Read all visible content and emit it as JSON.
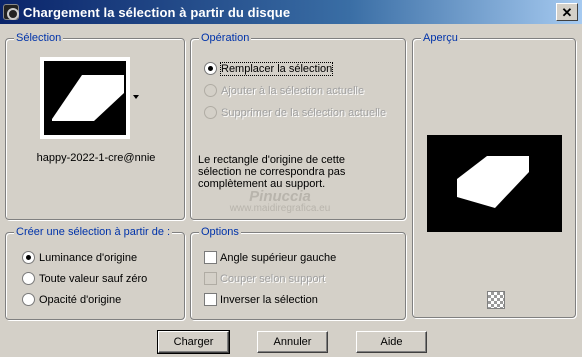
{
  "window": {
    "title": "Chargement la sélection à partir du disque",
    "close_label": "✕"
  },
  "selection_group": {
    "legend": "Sélection",
    "filename": "happy-2022-1-cre@nnie"
  },
  "operation_group": {
    "legend": "Opération",
    "options": [
      {
        "label": "Remplacer la sélection",
        "checked": true,
        "enabled": true
      },
      {
        "label": "Ajouter à la sélection actuelle",
        "checked": false,
        "enabled": false
      },
      {
        "label": "Supprimer de la sélection actuelle",
        "checked": false,
        "enabled": false
      }
    ],
    "message": "Le rectangle d'origine de cette sélection ne correspondra pas complètement au support."
  },
  "preview_group": {
    "legend": "Aperçu"
  },
  "create_group": {
    "legend": "Créer une sélection à partir de :",
    "options": [
      {
        "label": "Luminance d'origine",
        "checked": true
      },
      {
        "label": "Toute valeur sauf zéro",
        "checked": false
      },
      {
        "label": "Opacité d'origine",
        "checked": false
      }
    ]
  },
  "options_group": {
    "legend": "Options",
    "options": [
      {
        "label": "Angle supérieur gauche",
        "checked": false,
        "enabled": true
      },
      {
        "label": "Couper selon support",
        "checked": false,
        "enabled": false
      },
      {
        "label": "Inverser la sélection",
        "checked": false,
        "enabled": true
      }
    ]
  },
  "buttons": {
    "load": "Charger",
    "cancel": "Annuler",
    "help": "Aide"
  },
  "watermark": {
    "line1": "Pinuccia",
    "line2": "www.maidiregrafica.eu"
  },
  "colors": {
    "title_start": "#0a246a",
    "legend": "#0033aa",
    "face": "#d4d0c8"
  }
}
